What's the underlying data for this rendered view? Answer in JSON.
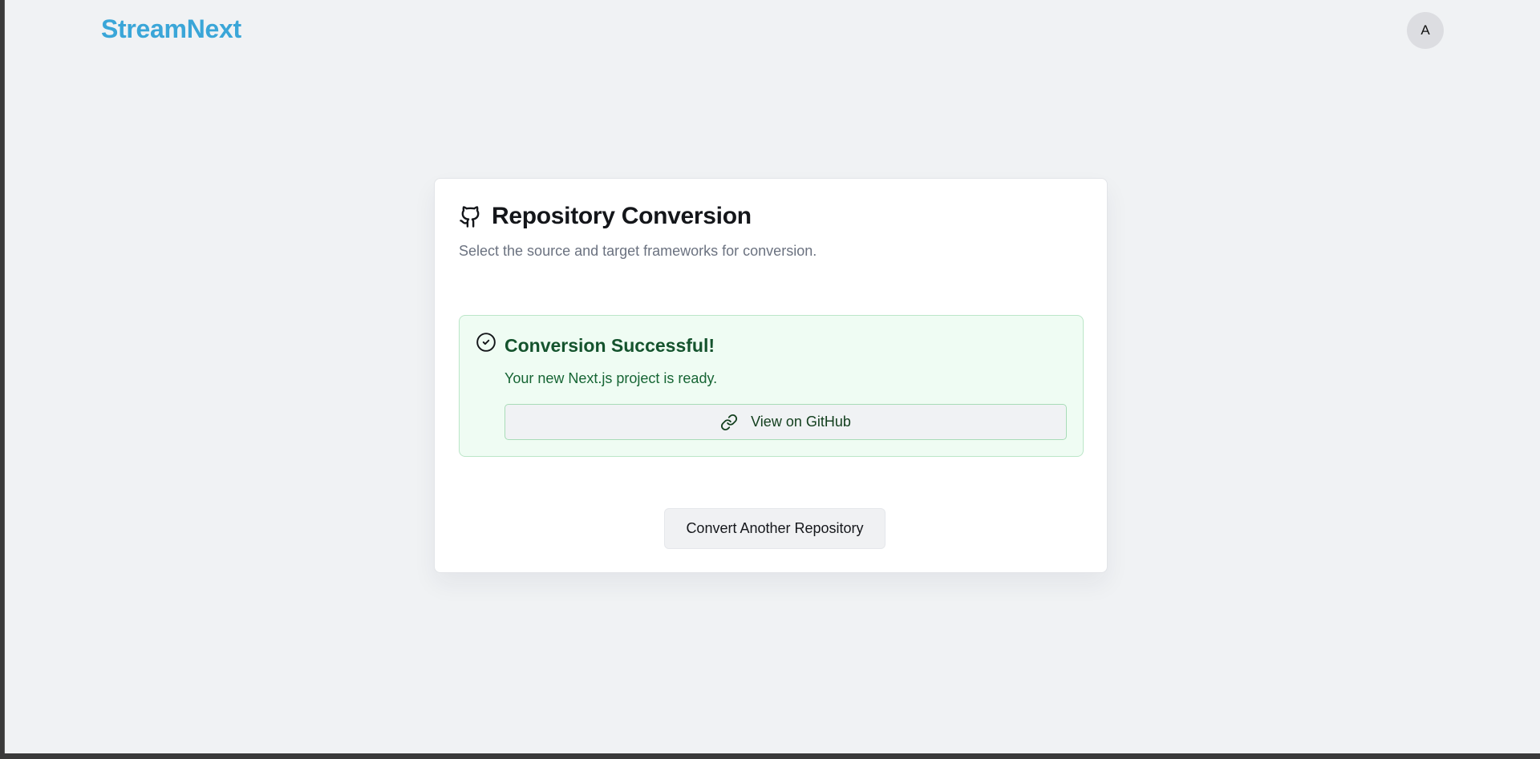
{
  "header": {
    "brand": "StreamNext",
    "avatar_initial": "A"
  },
  "card": {
    "title": "Repository Conversion",
    "title_icon": "github-icon",
    "subtitle": "Select the source and target frameworks for conversion."
  },
  "success": {
    "icon": "check-circle-icon",
    "title": "Conversion Successful!",
    "message": "Your new Next.js project is ready.",
    "button_icon": "link-icon",
    "button_label": "View on GitHub"
  },
  "actions": {
    "convert_another_label": "Convert Another Repository"
  },
  "colors": {
    "brand": "#3aa6d8",
    "success_bg": "#effcf3",
    "success_border": "#bbe6c8",
    "success_text": "#14532d"
  }
}
